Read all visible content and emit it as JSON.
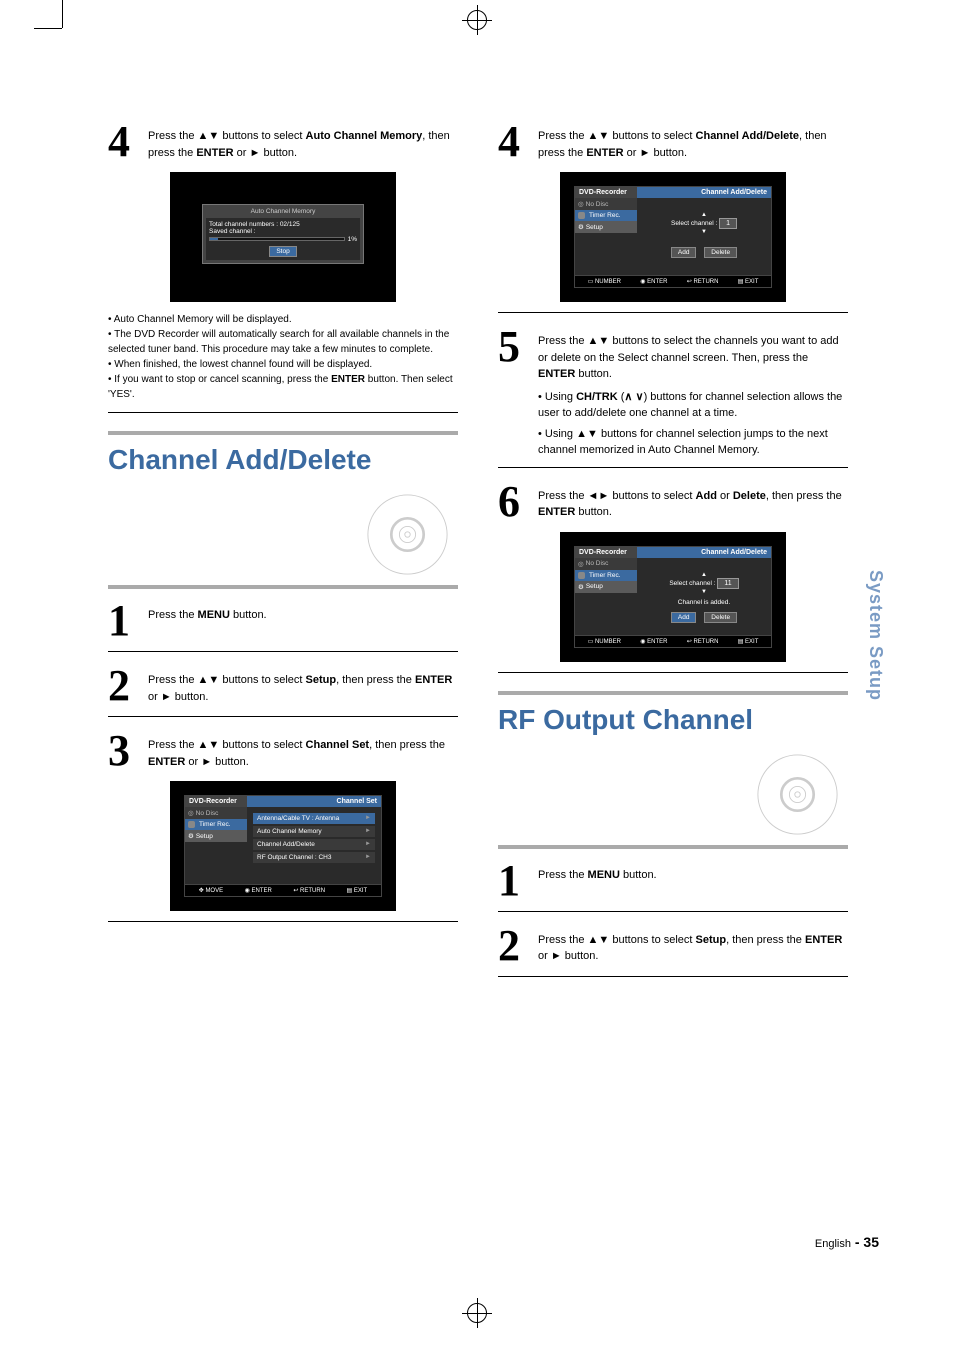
{
  "side_tab": "System Setup",
  "page_number_prefix": "English",
  "page_number": "- 35",
  "left": {
    "step4": {
      "text_parts": [
        "Press the ",
        "▲▼",
        " buttons to select ",
        "Auto Channel Memory",
        ", then press the ",
        "ENTER",
        " or ",
        "►",
        " button."
      ]
    },
    "acm_osd": {
      "title": "Auto Channel Memory",
      "line1": "Total channel numbers : 02/125",
      "line2": "Saved channel :",
      "percent": "1%",
      "stop": "Stop"
    },
    "note_lines": [
      "• Auto Channel Memory will be displayed.",
      "• The DVD Recorder will automatically search for all available channels in the selected tuner band. This procedure may take a few minutes to complete.",
      "• When finished, the lowest channel found will be displayed.",
      "• If you want to stop or cancel scanning, press the ENTER button. Then select 'YES'."
    ],
    "section_title": "Channel Add/Delete",
    "step1": {
      "text_parts": [
        "Press the ",
        "MENU",
        " button."
      ]
    },
    "step2": {
      "text_parts": [
        "Press the ",
        "▲▼",
        " buttons to select ",
        "Setup",
        ", then press the ",
        "ENTER",
        " or ",
        "►",
        " button."
      ]
    },
    "step3": {
      "text_parts": [
        "Press the ",
        "▲▼",
        " buttons to select ",
        "Channel Set",
        ", then press the ",
        "ENTER",
        " or ",
        "►",
        " button."
      ]
    },
    "chset_osd": {
      "header_left": "DVD-Recorder",
      "header_right": "Channel Set",
      "side_items": [
        "No Disc",
        "Timer Rec.",
        "Setup"
      ],
      "rows": [
        {
          "label": "Antenna/Cable TV",
          "value": ": Antenna",
          "hl": true
        },
        {
          "label": "Auto Channel Memory",
          "value": "",
          "hl": false
        },
        {
          "label": "Channel Add/Delete",
          "value": "",
          "hl": false
        },
        {
          "label": "RF Output Channel",
          "value": ": CH3",
          "hl": false
        }
      ],
      "footer": [
        "MOVE",
        "ENTER",
        "RETURN",
        "EXIT"
      ]
    }
  },
  "right": {
    "step4": {
      "text_parts": [
        "Press the ",
        "▲▼",
        " buttons to select ",
        "Channel Add/Delete",
        ", then press the ",
        "ENTER",
        " or ",
        "►",
        " button."
      ]
    },
    "cad_osd1": {
      "header_left": "DVD-Recorder",
      "header_right": "Channel Add/Delete",
      "side_items": [
        "No Disc",
        "Timer Rec.",
        "Setup"
      ],
      "select_label": "Select channel   :",
      "channel": "1",
      "buttons": [
        "Add",
        "Delete"
      ],
      "footer": [
        "NUMBER",
        "ENTER",
        "RETURN",
        "EXIT"
      ]
    },
    "step5": {
      "text_parts": [
        "Press the ",
        "▲▼",
        " buttons to select the channels you want to add or delete on the Select channel screen. Then, press the ",
        "ENTER",
        " button."
      ],
      "bullets": [
        [
          "Using ",
          "CH/TRK",
          " (",
          " ",
          ") buttons for channel selection allows the user to add/delete one channel at a time."
        ],
        [
          "Using ",
          "▲▼",
          " buttons for channel selection jumps to the next channel memorized in Auto Channel Memory."
        ]
      ],
      "chtrk_symbols": "∧ ∨"
    },
    "step6": {
      "text_parts": [
        "Press the ",
        "◄►",
        " buttons to select ",
        "Add",
        " or ",
        "Delete",
        ", then press the ",
        "ENTER",
        " button."
      ]
    },
    "cad_osd2": {
      "header_left": "DVD-Recorder",
      "header_right": "Channel Add/Delete",
      "side_items": [
        "No Disc",
        "Timer Rec.",
        "Setup"
      ],
      "select_label": "Select channel   :",
      "channel": "11",
      "status": "Channel is added.",
      "buttons": [
        "Add",
        "Delete"
      ],
      "footer": [
        "NUMBER",
        "ENTER",
        "RETURN",
        "EXIT"
      ]
    },
    "section_title": "RF Output Channel",
    "step1": {
      "text_parts": [
        "Press the ",
        "MENU",
        " button."
      ]
    },
    "step2": {
      "text_parts": [
        "Press the ",
        "▲▼",
        " buttons to select ",
        "Setup",
        ", then press the ",
        "ENTER",
        " or ",
        "►",
        " button."
      ]
    }
  }
}
